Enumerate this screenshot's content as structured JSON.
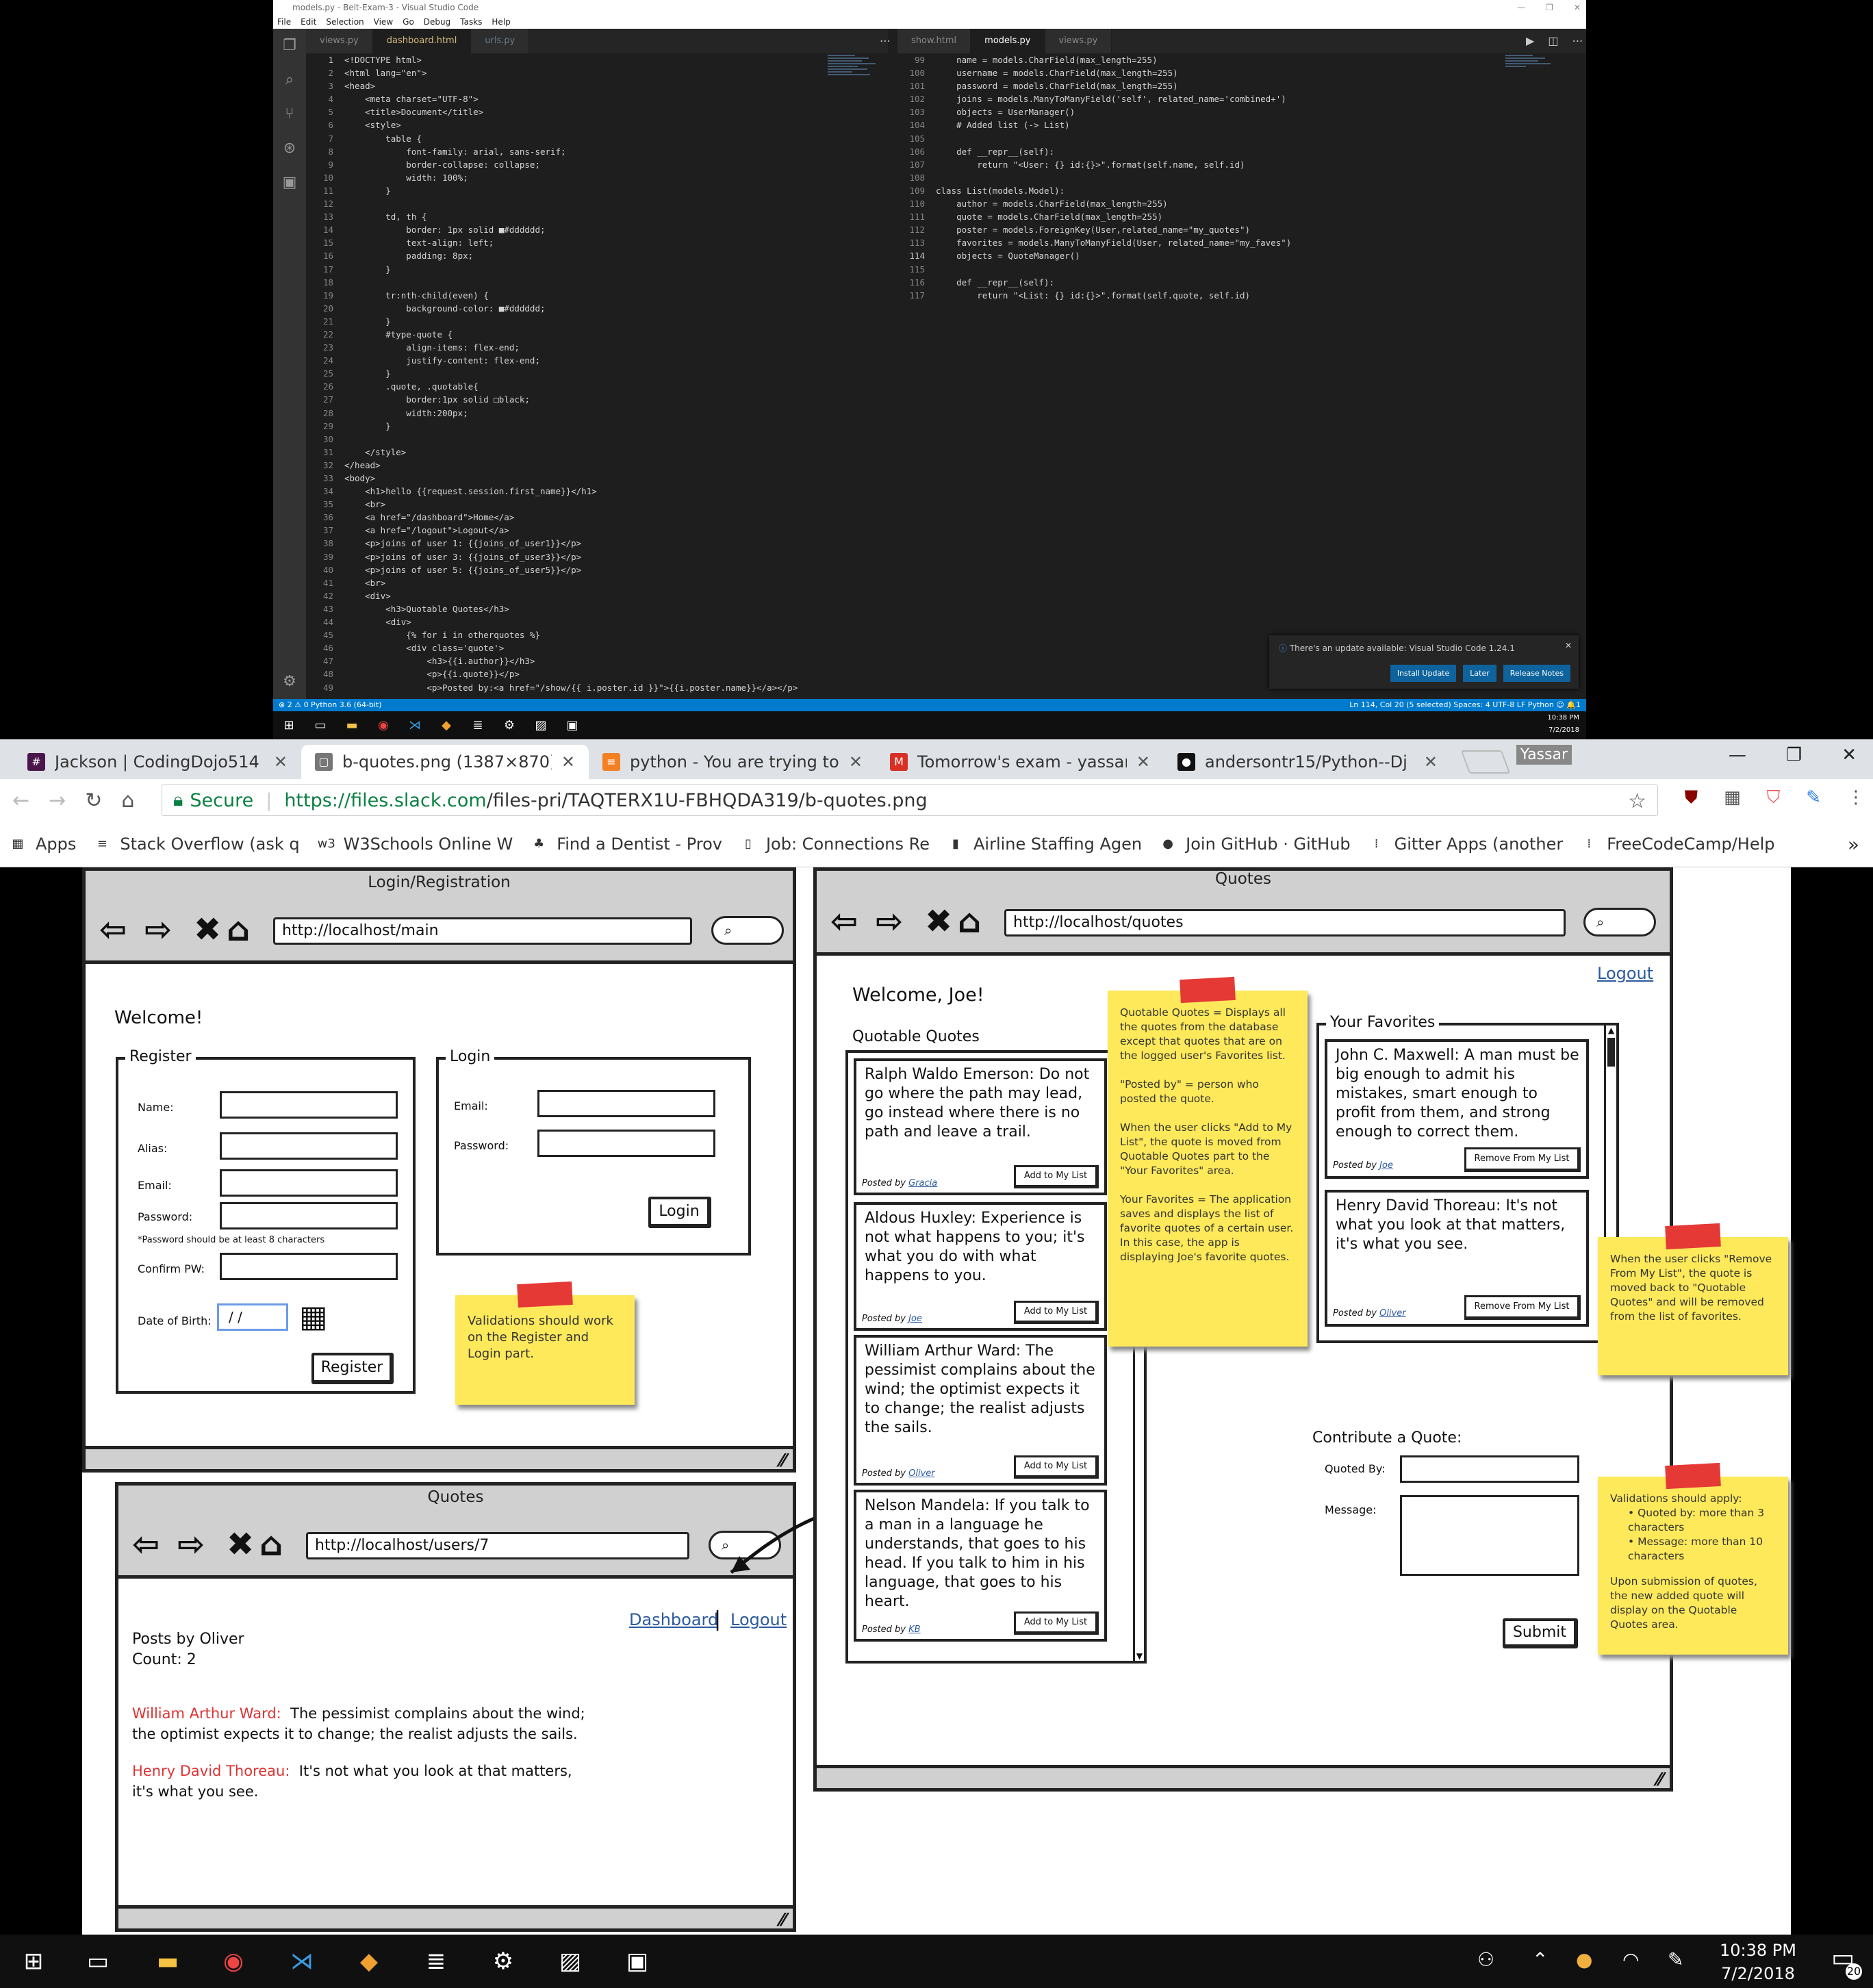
{
  "vscode": {
    "title": "models.py - Belt-Exam-3 - Visual Studio Code",
    "menu": [
      "File",
      "Edit",
      "Selection",
      "View",
      "Go",
      "Debug",
      "Tasks",
      "Help"
    ],
    "left_tabs": [
      "views.py",
      "dashboard.html",
      "urls.py"
    ],
    "right_tabs": [
      "show.html",
      "models.py",
      "views.py"
    ],
    "left_code": [
      {
        "n": "1",
        "c": "<!DOCTYPE html>"
      },
      {
        "n": "2",
        "c": "<html lang=\"en\">"
      },
      {
        "n": "3",
        "c": "<head>"
      },
      {
        "n": "4",
        "c": "    <meta charset=\"UTF-8\">"
      },
      {
        "n": "5",
        "c": "    <title>Document</title>"
      },
      {
        "n": "6",
        "c": "    <style>"
      },
      {
        "n": "7",
        "c": "        table {"
      },
      {
        "n": "8",
        "c": "            font-family: arial, sans-serif;"
      },
      {
        "n": "9",
        "c": "            border-collapse: collapse;"
      },
      {
        "n": "10",
        "c": "            width: 100%;"
      },
      {
        "n": "11",
        "c": "        }"
      },
      {
        "n": "12",
        "c": ""
      },
      {
        "n": "13",
        "c": "        td, th {"
      },
      {
        "n": "14",
        "c": "            border: 1px solid ■#dddddd;"
      },
      {
        "n": "15",
        "c": "            text-align: left;"
      },
      {
        "n": "16",
        "c": "            padding: 8px;"
      },
      {
        "n": "17",
        "c": "        }"
      },
      {
        "n": "18",
        "c": ""
      },
      {
        "n": "19",
        "c": "        tr:nth-child(even) {"
      },
      {
        "n": "20",
        "c": "            background-color: ■#dddddd;"
      },
      {
        "n": "21",
        "c": "        }"
      },
      {
        "n": "22",
        "c": "        #type-quote {"
      },
      {
        "n": "23",
        "c": "            align-items: flex-end;"
      },
      {
        "n": "24",
        "c": "            justify-content: flex-end;"
      },
      {
        "n": "25",
        "c": "        }"
      },
      {
        "n": "26",
        "c": "        .quote, .quotable{"
      },
      {
        "n": "27",
        "c": "            border:1px solid □black;"
      },
      {
        "n": "28",
        "c": "            width:200px;"
      },
      {
        "n": "29",
        "c": "        }"
      },
      {
        "n": "30",
        "c": ""
      },
      {
        "n": "31",
        "c": "    </style>"
      },
      {
        "n": "32",
        "c": "</head>"
      },
      {
        "n": "33",
        "c": "<body>"
      },
      {
        "n": "34",
        "c": "    <h1>hello {{request.session.first_name}}</h1>"
      },
      {
        "n": "35",
        "c": "    <br>"
      },
      {
        "n": "36",
        "c": "    <a href=\"/dashboard\">Home</a>"
      },
      {
        "n": "37",
        "c": "    <a href=\"/logout\">Logout</a>"
      },
      {
        "n": "38",
        "c": "    <p>joins of user 1: {{joins_of_user1}}</p>"
      },
      {
        "n": "39",
        "c": "    <p>joins of user 3: {{joins_of_user3}}</p>"
      },
      {
        "n": "40",
        "c": "    <p>joins of user 5: {{joins_of_user5}}</p>"
      },
      {
        "n": "41",
        "c": "    <br>"
      },
      {
        "n": "42",
        "c": "    <div>"
      },
      {
        "n": "43",
        "c": "        <h3>Quotable Quotes</h3>"
      },
      {
        "n": "44",
        "c": "        <div>"
      },
      {
        "n": "45",
        "c": "            {% for i in otherquotes %}"
      },
      {
        "n": "46",
        "c": "            <div class='quote'>"
      },
      {
        "n": "47",
        "c": "                <h3>{{i.author}}</h3>"
      },
      {
        "n": "48",
        "c": "                <p>{{i.quote}}</p>"
      },
      {
        "n": "49",
        "c": "                <p>Posted by:<a href=\"/show/{{ i.poster.id }}\">{{i.poster.name}}</a></p>"
      }
    ],
    "right_code": [
      {
        "n": "99",
        "c": "    name = models.CharField(max_length=255)"
      },
      {
        "n": "100",
        "c": "    username = models.CharField(max_length=255)"
      },
      {
        "n": "101",
        "c": "    password = models.CharField(max_length=255)"
      },
      {
        "n": "102",
        "c": "    joins = models.ManyToManyField('self', related_name='combined+')"
      },
      {
        "n": "103",
        "c": "    objects = UserManager()"
      },
      {
        "n": "104",
        "c": "    # Added list (-> List)"
      },
      {
        "n": "105",
        "c": ""
      },
      {
        "n": "106",
        "c": "    def __repr__(self):"
      },
      {
        "n": "107",
        "c": "        return \"<User: {} id:{}>\".format(self.name, self.id)"
      },
      {
        "n": "108",
        "c": ""
      },
      {
        "n": "109",
        "c": "class List(models.Model):"
      },
      {
        "n": "110",
        "c": "    author = models.CharField(max_length=255)"
      },
      {
        "n": "111",
        "c": "    quote = models.CharField(max_length=255)"
      },
      {
        "n": "112",
        "c": "    poster = models.ForeignKey(User,related_name=\"my_quotes\")"
      },
      {
        "n": "113",
        "c": "    favorites = models.ManyToManyField(User, related_name=\"my_faves\")"
      },
      {
        "n": "114",
        "c": "    objects = QuoteManager()"
      },
      {
        "n": "115",
        "c": ""
      },
      {
        "n": "116",
        "c": "    def __repr__(self):"
      },
      {
        "n": "117",
        "c": "        return \"<List: {} id:{}>\".format(self.quote, self.id)"
      }
    ],
    "status_left": "⊗ 2 ⚠ 0   Python 3.6 (64-bit)",
    "status_right": "Ln 114, Col 20 (5 selected)   Spaces: 4   UTF-8   LF   Python   ☺   🔔1",
    "notification": "There's an update available: Visual Studio Code 1.24.1",
    "notif_buttons": [
      "Install Update",
      "Later",
      "Release Notes"
    ],
    "clock_time": "10:38 PM",
    "clock_date": "7/2/2018"
  },
  "chrome": {
    "tabs": [
      {
        "title": "Jackson | CodingDojo514",
        "icon": "#",
        "color": "#4a154b"
      },
      {
        "title": "b-quotes.png (1387×870)",
        "icon": "▢",
        "color": "#777"
      },
      {
        "title": "python - You are trying to",
        "icon": "≡",
        "color": "#f48024"
      },
      {
        "title": "Tomorrow's exam - yassar",
        "icon": "M",
        "color": "#d93025"
      },
      {
        "title": "andersontr15/Python--Dj",
        "icon": "●",
        "color": "#111"
      }
    ],
    "user": "Yassar",
    "secure": "Secure",
    "url_host": "https://files.slack.com",
    "url_path": "/files-pri/TAQTERX1U-FBHQDA319/b-quotes.png",
    "bookmarks": [
      {
        "label": "Apps",
        "icon": "▦"
      },
      {
        "label": "Stack Overflow (ask q",
        "icon": "≡"
      },
      {
        "label": "W3Schools Online W",
        "icon": "w3"
      },
      {
        "label": "Find a Dentist - Prov",
        "icon": "♣"
      },
      {
        "label": "Job: Connections Re",
        "icon": "▯"
      },
      {
        "label": "Airline Staffing Agen",
        "icon": "▮"
      },
      {
        "label": "Join GitHub · GitHub",
        "icon": "●"
      },
      {
        "label": "Gitter Apps (another",
        "icon": "⁞"
      },
      {
        "label": "FreeCodeCamp/Help",
        "icon": "⁞"
      }
    ]
  },
  "mockup": {
    "login": {
      "title": "Login/Registration",
      "url": "http://localhost/main",
      "welcome": "Welcome!",
      "register": "Register",
      "name": "Name:",
      "alias": "Alias:",
      "email": "Email:",
      "password": "Password:",
      "pw_note": "*Password should be at least 8 characters",
      "confirm": "Confirm PW:",
      "dob": "Date of Birth:",
      "dob_value": "/ /",
      "register_btn": "Register",
      "login": "Login",
      "login_email": "Email:",
      "login_password": "Password:",
      "login_btn": "Login",
      "sticky": "Validations should work on the Register and Login part."
    },
    "users": {
      "title": "Quotes",
      "url": "http://localhost/users/7",
      "dashboard": "Dashboard",
      "logout": "Logout",
      "posts_by": "Posts by Oliver",
      "count": "Count: 2",
      "posts": [
        {
          "author": "William Arthur Ward:",
          "line1": "The pessimist complains about the wind;",
          "line2": "the optimist expects it to change; the realist adjusts the sails."
        },
        {
          "author": "Henry David Thoreau:",
          "line1": "It's not what you look at that matters,",
          "line2": "it's what you see."
        }
      ]
    },
    "quotes": {
      "title": "Quotes",
      "url": "http://localhost/quotes",
      "logout": "Logout",
      "welcome": "Welcome, Joe!",
      "quotable": "Quotable Quotes",
      "favorites": "Your Favorites",
      "add_btn": "Add to My List",
      "remove_btn": "Remove From My List",
      "posted_by": "Posted by",
      "cards": [
        {
          "text": "Ralph Waldo Emerson: Do not go where the path may lead, go instead where there is no path and leave a trail.",
          "poster": "Gracia"
        },
        {
          "text": "Aldous Huxley: Experience is not what happens to you; it's what you do with what happens to you.",
          "poster": "Joe"
        },
        {
          "text": "William Arthur Ward: The pessimist complains about the wind; the optimist expects it to change; the realist adjusts the sails.",
          "poster": "Oliver"
        },
        {
          "text": "Nelson Mandela: If you talk to a man in a language he understands, that goes to his head. If you talk to him in his language, that goes to his heart.",
          "poster": "KB"
        }
      ],
      "favs": [
        {
          "text": "John C. Maxwell: A man must be big enough to admit his mistakes, smart enough to profit from them, and strong enough to correct them.",
          "poster": "Joe"
        },
        {
          "text": "Henry David Thoreau: It's not what you look at that matters, it's what you see.",
          "poster": "Oliver"
        }
      ],
      "contribute": "Contribute a Quote:",
      "quoted_by": "Quoted By:",
      "message": "Message:",
      "submit": "Submit",
      "sticky_quotable": "Quotable Quotes = Displays all the quotes from the database except that quotes that are on the logged user's Favorites list.\n\n\"Posted by\" = person who posted the quote.\n\nWhen the user clicks \"Add to My List\", the quote is moved from Quotable Quotes part to the \"Your Favorites\" area.\n\nYour Favorites = The application saves and displays the list of favorite quotes of a certain user. In this case, the app is displaying Joe's favorite quotes.",
      "sticky_remove": "When the user clicks \"Remove From My List\", the quote is moved back to \"Quotable Quotes\" and will be removed from the list of favorites.",
      "sticky_valid_title": "Validations should apply:",
      "sticky_valid_1": "Quoted by: more than 3 characters",
      "sticky_valid_2": "Message: more than 10 characters",
      "sticky_valid_3": "Upon submission of quotes, the new added quote will display on the Quotable Quotes area."
    }
  },
  "taskbar": {
    "time": "10:38 PM",
    "date": "7/2/2018",
    "notifications": "20"
  }
}
